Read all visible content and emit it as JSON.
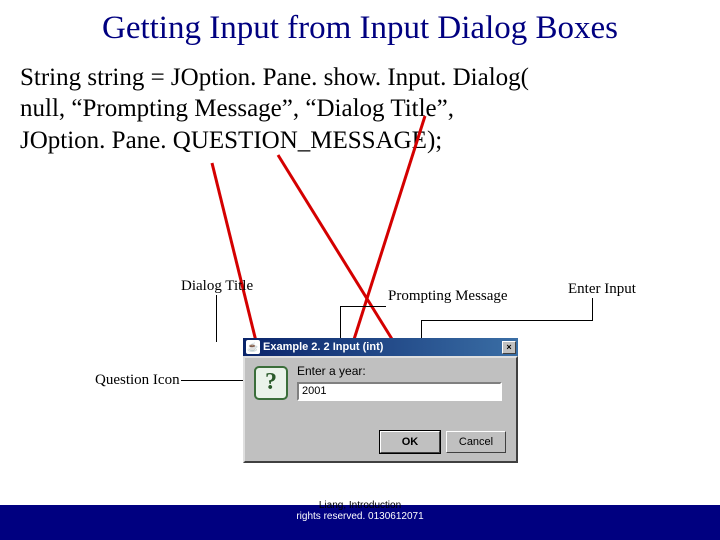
{
  "title": "Getting Input from Input Dialog Boxes",
  "code": {
    "line1": "String string = JOption. Pane. show. Input. Dialog(",
    "line2": "  null, “Prompting Message”,  “Dialog Title”,",
    "line3": "  JOption. Pane. QUESTION_MESSAGE);"
  },
  "labels": {
    "dialog_title": "Dialog Title",
    "prompting_message": "Prompting Message",
    "enter_input": "Enter Input",
    "question_icon": "Question Icon"
  },
  "dialog": {
    "window_title": "Example 2. 2 Input (int)",
    "java_icon_glyph": "☕",
    "close_glyph": "×",
    "question_glyph": "?",
    "prompt": "Enter a year:",
    "input_value": "2001",
    "ok": "OK",
    "cancel": "Cancel"
  },
  "footer": {
    "line1_left": "Liang, Introduction",
    "line2": "rights reserved. 0130612071"
  }
}
